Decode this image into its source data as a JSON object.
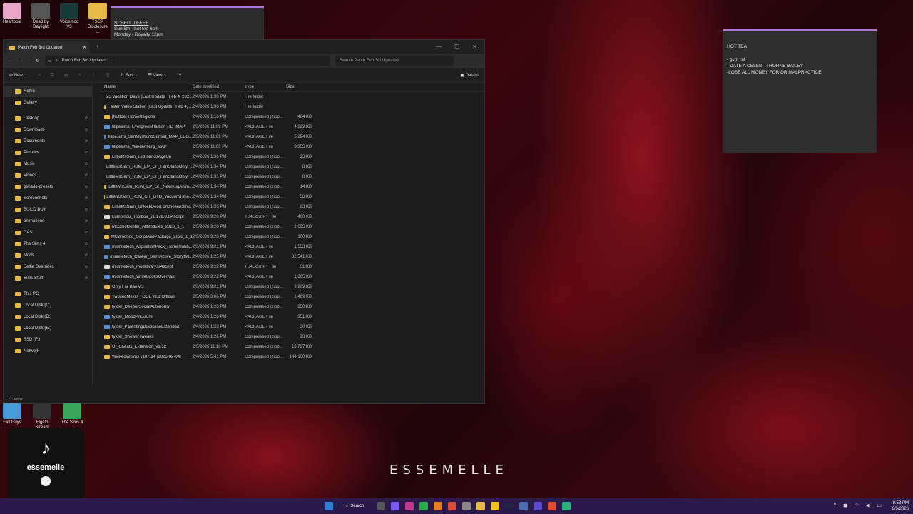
{
  "desktop_icons": [
    {
      "label": "Heartopia",
      "color": "#e8a6c8"
    },
    {
      "label": "Dead by Daylight",
      "color": "#555"
    },
    {
      "label": "Voicemod V3",
      "color": "#1a3a3a"
    },
    {
      "label": "TSCP Disclosure ...",
      "color": "#e6b84a"
    }
  ],
  "schedule_note": {
    "title": "SCHEDULEEEE",
    "line1": "Sun 8th - hot tea 6pm",
    "line2": "Monday - Royalty 12pm"
  },
  "sticky_note": {
    "title": "HOT TEA",
    "lines": [
      "- gym rat",
      "- DATE A CELEB - THORNE BAILEY",
      "-LOSE ALL MONEY FOR DR MALPRACTICE"
    ]
  },
  "explorer": {
    "tab_title": "Patch Feb 3rd Updated",
    "address": "Patch Feb 3rd Updated",
    "search_placeholder": "Search Patch Feb 3rd Updated",
    "cmd": {
      "new": "New",
      "sort": "Sort",
      "view": "View",
      "details": "Details"
    },
    "nav": [
      {
        "label": "Home",
        "sel": true
      },
      {
        "label": "Gallery"
      },
      {
        "sep": true
      },
      {
        "label": "Desktop",
        "pin": true
      },
      {
        "label": "Downloads",
        "pin": true
      },
      {
        "label": "Documents",
        "pin": true
      },
      {
        "label": "Pictures",
        "pin": true
      },
      {
        "label": "Music",
        "pin": true
      },
      {
        "label": "Videos",
        "pin": true
      },
      {
        "label": "gshade-presets",
        "pin": true
      },
      {
        "label": "Screenshots",
        "pin": true
      },
      {
        "label": "BUILD BUY",
        "pin": true
      },
      {
        "label": "animations",
        "pin": true
      },
      {
        "label": "CAS",
        "pin": true
      },
      {
        "label": "The Sims 4",
        "pin": true
      },
      {
        "label": "Mods",
        "pin": true
      },
      {
        "label": "Selfie Overrides",
        "pin": true
      },
      {
        "label": "Sims Stuff",
        "pin": true
      },
      {
        "sep": true
      },
      {
        "label": "This PC"
      },
      {
        "label": "Local Disk (C:)"
      },
      {
        "label": "Local Disk (D:)"
      },
      {
        "label": "Local Disk (E:)"
      },
      {
        "label": "SSD (F:)"
      },
      {
        "label": "Network"
      }
    ],
    "columns": {
      "name": "Name",
      "date": "Date modified",
      "type": "Type",
      "size": "Size"
    },
    "files": [
      [
        "25 Vacation Days (Last Update_ Feb 4, 202...",
        "2/4/2026 1:30 PM",
        "File folder",
        ""
      ],
      [
        "Faster Video Station (Last Update_ Feb 4, ...",
        "2/4/2026 1:30 PM",
        "File folder",
        ""
      ],
      [
        "[Kuttoe] HomeRegions",
        "2/4/2026 1:18 PM",
        "Compressed (zipp...",
        "484 KB"
      ],
      [
        "filipesims_EvergreenHarbor_HD_MAP",
        "2/3/2026 11:09 PM",
        "PACKAGE File",
        "4,329 KB"
      ],
      [
        "filipesims_SanMyshunoSunset_MAP_LEG...",
        "2/3/2026 11:09 PM",
        "PACKAGE File",
        "5,294 KB"
      ],
      [
        "filipesims_Windenburg_MAP",
        "2/3/2026 11:09 PM",
        "PACKAGE File",
        "3,355 KB"
      ],
      [
        "LittleMsSam_LetFriendsAgeUp",
        "2/4/2026 1:36 PM",
        "Compressed (zipp...",
        "23 KB"
      ],
      [
        "LittleMsSam_RSM_EP_GF_FanStansOnlyH...",
        "2/4/2026 1:34 PM",
        "Compressed (zipp...",
        "8 KB"
      ],
      [
        "LittleMsSam_RSM_EP_GF_FanStansOnlyH...",
        "2/4/2026 1:31 PM",
        "Compressed (zipp...",
        "8 KB"
      ],
      [
        "LittleMsSam_RSM_EP_GF_NewHugAnim...",
        "2/4/2026 1:34 PM",
        "Compressed (zipp...",
        "14 KB"
      ],
      [
        "LittleMsSam_RSM_KIT_BTD_VacuumTime...",
        "2/4/2026 1:34 PM",
        "Compressed (zipp...",
        "58 KB"
      ],
      [
        "LittleMsSam_UnlockDoorForChosenSims",
        "2/4/2026 1:36 PM",
        "Compressed (zipp...",
        "63 KB"
      ],
      [
        "Lumpinou_Toolbox_v1.179.6.ts4script",
        "2/3/2026 9:20 PM",
        "TS4SCRIPT File",
        "400 KB"
      ],
      [
        "McCmdCenter_AllModules_2026_1_1",
        "2/3/2026 9:20 PM",
        "Compressed (zipp...",
        "2,095 KB"
      ],
      [
        "MCWoohoo_ScriptAndPackage_2026_1_1",
        "2/3/2026 9:20 PM",
        "Compressed (zipp...",
        "100 KB"
      ],
      [
        "midnitetech_AspirationPack_HomeHobb...",
        "2/3/2026 9:21 PM",
        "PACKAGE File",
        "1,553 KB"
      ],
      [
        "midnitetech_Career_SemiActive_Storytell...",
        "2/4/2026 1:25 PM",
        "PACKAGE File",
        "32,541 KB"
      ],
      [
        "midnitetech_modlibrary.ts4script",
        "2/3/2026 9:22 PM",
        "TS4SCRIPT File",
        "31 KB"
      ],
      [
        "midnitetech_WriteBooksOverhaul",
        "2/3/2026 9:22 PM",
        "PACKAGE File",
        "1,265 KB"
      ],
      [
        "Only For Bae v.3",
        "2/3/2026 9:21 PM",
        "Compressed (zipp...",
        "9,269 KB"
      ],
      [
        "TwistedMexi's TOOL v3.1 Official",
        "2/5/2026 3:06 PM",
        "Compressed (zipp...",
        "1,469 KB"
      ],
      [
        "tyjokr_DeeperSocialAutonomy",
        "2/4/2026 1:28 PM",
        "Compressed (zipp...",
        "250 KB"
      ],
      [
        "tyjokr_MoodPressure",
        "2/4/2026 1:28 PM",
        "PACKAGE File",
        "351 KB"
      ],
      [
        "tyjokr_ParentingDisciplineExtended",
        "2/4/2026 1:28 PM",
        "PACKAGE File",
        "30 KB"
      ],
      [
        "tyjokr_ShowerTweaks",
        "2/4/2026 1:28 PM",
        "Compressed (zipp...",
        "23 KB"
      ],
      [
        "UI_Cheats_Extension_v1.52",
        "2/3/2026 11:10 PM",
        "Compressed (zipp...",
        "13,727 KB"
      ],
      [
        "WickedWhims v187.14 [2026-02-04]",
        "2/4/2026 5:41 PM",
        "Compressed (zipp...",
        "144,100 KB"
      ]
    ],
    "status": "27 items"
  },
  "bottom_icons": [
    {
      "label": "Fall Guys"
    },
    {
      "label": "Elgato Stream Deck"
    },
    {
      "label": "The Sims 4"
    }
  ],
  "tiktok": {
    "name": "essemelle"
  },
  "brand": "ESSEMELLE",
  "taskbar": {
    "search": "Search",
    "time": "9:53 PM",
    "date": "2/5/2026"
  }
}
